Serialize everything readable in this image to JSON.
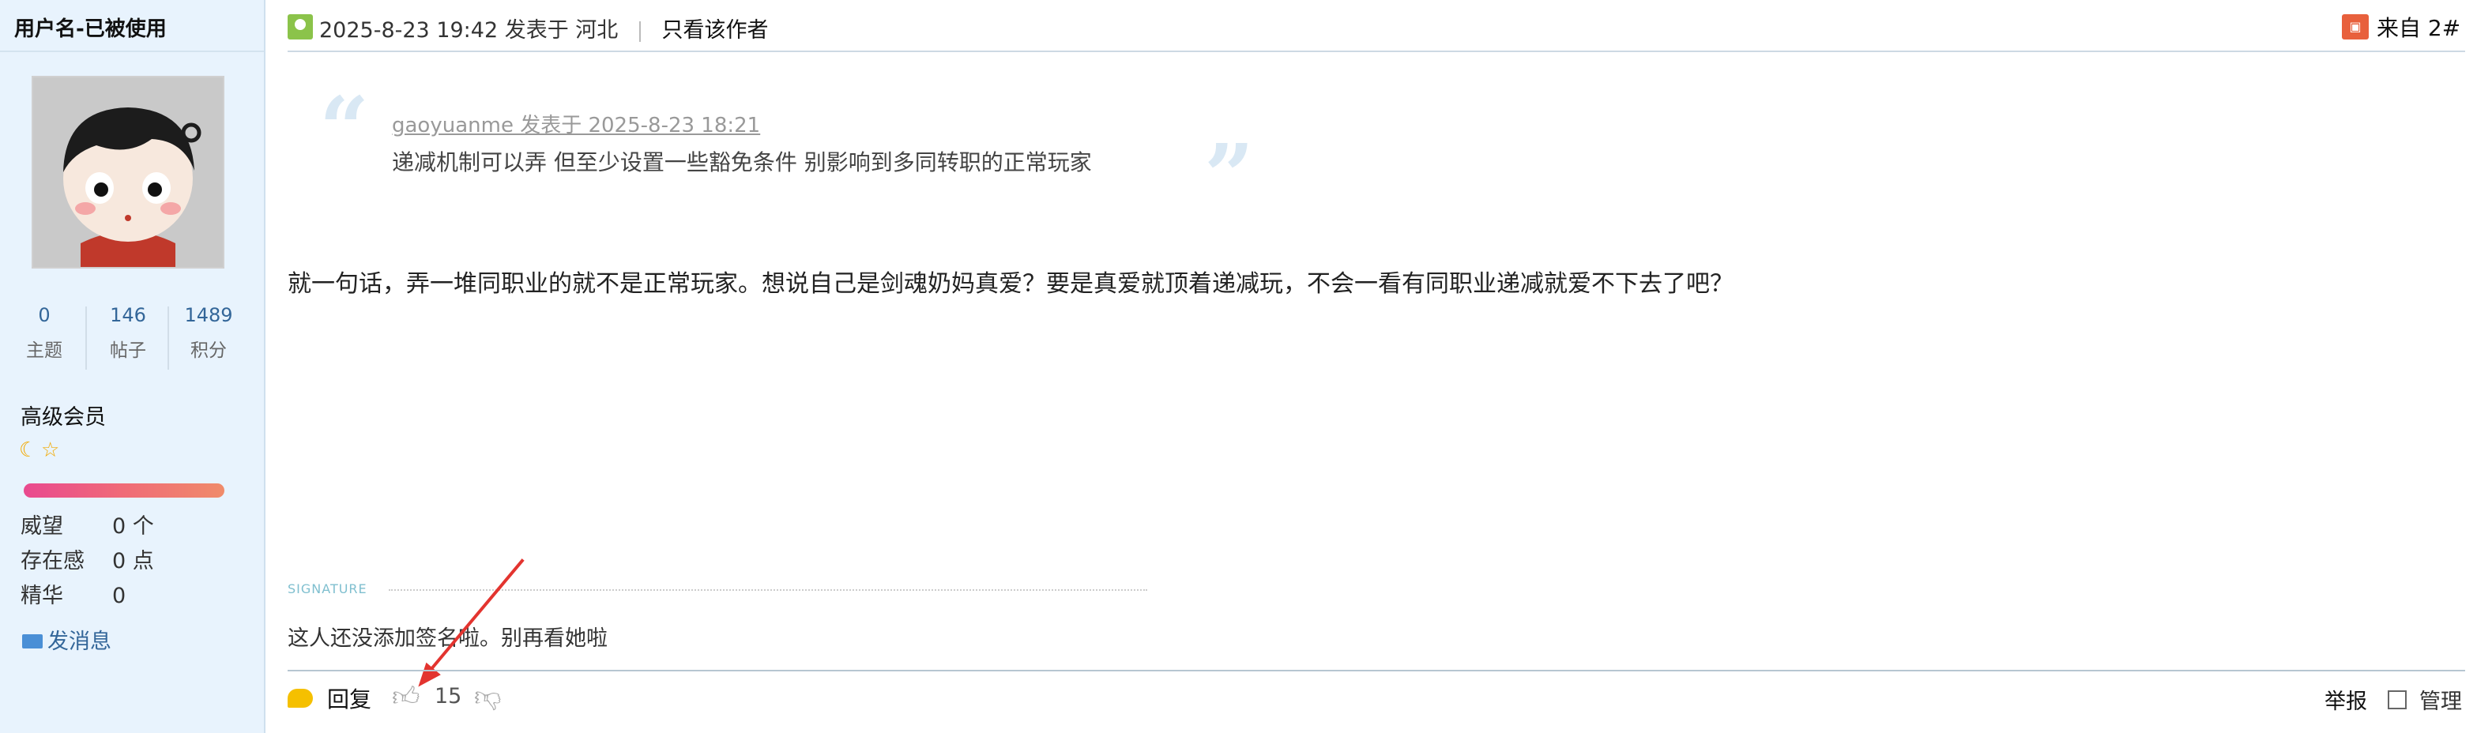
{
  "user": {
    "name": "用户名-已被使用",
    "stats": [
      {
        "value": "0",
        "label": "主题"
      },
      {
        "value": "146",
        "label": "帖子"
      },
      {
        "value": "1489",
        "label": "积分"
      }
    ],
    "group": "高级会员",
    "rank_icons": [
      "moon-icon",
      "star-icon"
    ],
    "fields": [
      {
        "key": "威望",
        "value": "0 个"
      },
      {
        "key": "存在感",
        "value": "0 点"
      },
      {
        "key": "精华",
        "value": "0"
      }
    ],
    "send_message": "发消息"
  },
  "post": {
    "timestamp": "2025-8-23 19:42",
    "posted_in": "发表于 河北",
    "only_author": "只看该作者",
    "from_label": "来自",
    "floor": "2#",
    "quote": {
      "author_line": "gaoyuanme 发表于 2025-8-23 18:21",
      "text": "递减机制可以弄 但至少设置一些豁免条件 别影响到多同转职的正常玩家"
    },
    "body": "就一句话，弄一堆同职业的就不是正常玩家。想说自己是剑魂奶妈真爱？要是真爱就顶着递减玩，不会一看有同职业递减就爱不下去了吧？",
    "signature_label": "SIGNATURE",
    "signature": "这人还没添加签名啦。别再看她啦"
  },
  "footer": {
    "reply": "回复",
    "support_count": "15",
    "report": "举报",
    "manage": "管理"
  },
  "colors": {
    "sidebar_bg": "#e8f3fd",
    "link": "#336699",
    "annotation_arrow": "#e3342f"
  }
}
